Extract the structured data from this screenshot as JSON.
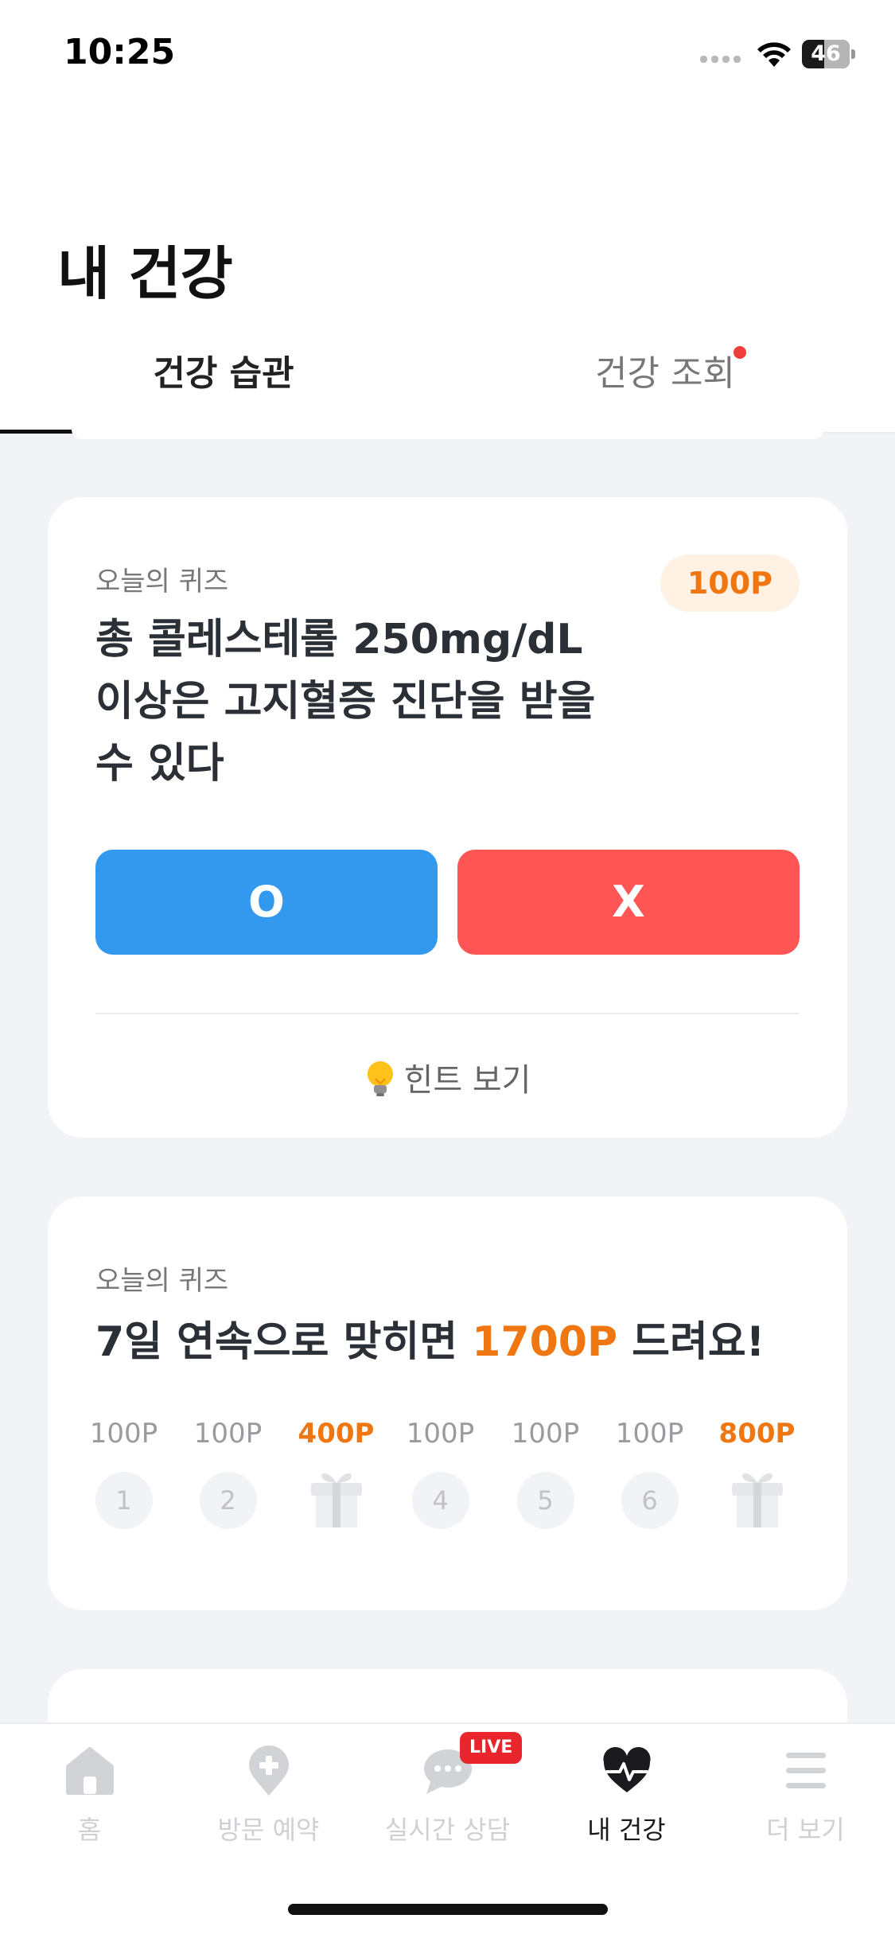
{
  "status_bar": {
    "time": "10:25",
    "battery": "46",
    "battery_level": 0.46
  },
  "header": {
    "title": "내 건강",
    "tabs": [
      {
        "label": "건강 습관",
        "active": true
      },
      {
        "label": "건강 조회",
        "active": false,
        "has_dot": true
      }
    ]
  },
  "quiz_card": {
    "label": "오늘의 퀴즈",
    "points": "100P",
    "question_lines": [
      "총 콜레스테롤 250mg/dL",
      "이상은 고지혈증 진단을 받을",
      "수 있다"
    ],
    "answer_o": "O",
    "answer_x": "X",
    "hint": "힌트 보기"
  },
  "streak_card": {
    "label": "오늘의 퀴즈",
    "title_prefix": "7일 연속으로 맞히면 ",
    "title_highlight": "1700P",
    "title_suffix": " 드려요!",
    "days": [
      {
        "points": "100P",
        "day": "1",
        "gift": false
      },
      {
        "points": "100P",
        "day": "2",
        "gift": false
      },
      {
        "points": "400P",
        "day": "",
        "gift": true
      },
      {
        "points": "100P",
        "day": "4",
        "gift": false
      },
      {
        "points": "100P",
        "day": "5",
        "gift": false
      },
      {
        "points": "100P",
        "day": "6",
        "gift": false
      },
      {
        "points": "800P",
        "day": "",
        "gift": true
      }
    ]
  },
  "bottom_nav": {
    "items": [
      {
        "label": "홈",
        "icon": "home-icon",
        "active": false
      },
      {
        "label": "방문 예약",
        "icon": "location-plus-icon",
        "active": false
      },
      {
        "label": "실시간 상담",
        "icon": "chat-bubble-icon",
        "active": false,
        "badge": "LIVE"
      },
      {
        "label": "내 건강",
        "icon": "heart-pulse-icon",
        "active": true
      },
      {
        "label": "더 보기",
        "icon": "menu-icon",
        "active": false
      }
    ]
  },
  "colors": {
    "accent_orange": "#ef7611",
    "o_button": "#3399ee",
    "x_button": "#ff5555",
    "live_red": "#e8262b",
    "background": "#f2f3f6"
  }
}
